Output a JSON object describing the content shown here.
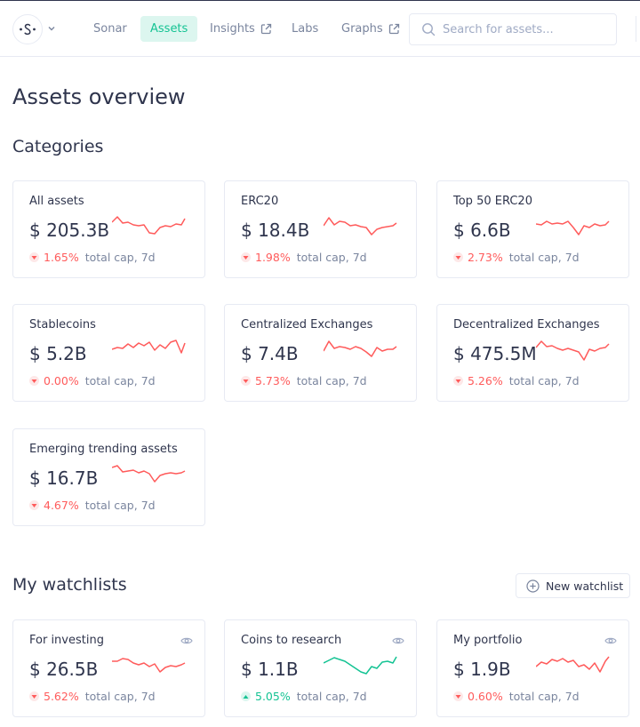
{
  "nav": {
    "items": [
      {
        "label": "Sonar",
        "active": false,
        "external": false
      },
      {
        "label": "Assets",
        "active": true,
        "external": false
      },
      {
        "label": "Insights",
        "active": false,
        "external": true
      },
      {
        "label": "Labs",
        "active": false,
        "external": false
      },
      {
        "label": "Graphs",
        "active": false,
        "external": true
      }
    ],
    "search_placeholder": "Search for assets..."
  },
  "page_title": "Assets overview",
  "categories": {
    "title": "Categories",
    "cards": [
      {
        "title": "All assets",
        "value": "$ 205.3B",
        "change": "1.65%",
        "direction": "down",
        "label": "total cap, 7d"
      },
      {
        "title": "ERC20",
        "value": "$ 18.4B",
        "change": "1.98%",
        "direction": "down",
        "label": "total cap, 7d"
      },
      {
        "title": "Top 50 ERC20",
        "value": "$ 6.6B",
        "change": "2.73%",
        "direction": "down",
        "label": "total cap, 7d"
      },
      {
        "title": "Stablecoins",
        "value": "$ 5.2B",
        "change": "0.00%",
        "direction": "down",
        "label": "total cap, 7d"
      },
      {
        "title": "Centralized Exchanges",
        "value": "$ 7.4B",
        "change": "5.73%",
        "direction": "down",
        "label": "total cap, 7d"
      },
      {
        "title": "Decentralized Exchanges",
        "value": "$ 475.5M",
        "change": "5.26%",
        "direction": "down",
        "label": "total cap, 7d"
      },
      {
        "title": "Emerging trending assets",
        "value": "$ 16.7B",
        "change": "4.67%",
        "direction": "down",
        "label": "total cap, 7d"
      }
    ]
  },
  "watchlists": {
    "title": "My watchlists",
    "new_button": "New watchlist",
    "cards": [
      {
        "title": "For investing",
        "value": "$ 26.5B",
        "change": "5.62%",
        "direction": "down",
        "label": "total cap, 7d"
      },
      {
        "title": "Coins to research",
        "value": "$ 1.1B",
        "change": "5.05%",
        "direction": "up",
        "label": "total cap, 7d"
      },
      {
        "title": "My portfolio",
        "value": "$ 1.9B",
        "change": "0.60%",
        "direction": "down",
        "label": "total cap, 7d"
      }
    ]
  },
  "colors": {
    "accent": "#14c393",
    "down": "#ff5b5b",
    "up": "#14c393",
    "border": "#e7eaf3"
  }
}
